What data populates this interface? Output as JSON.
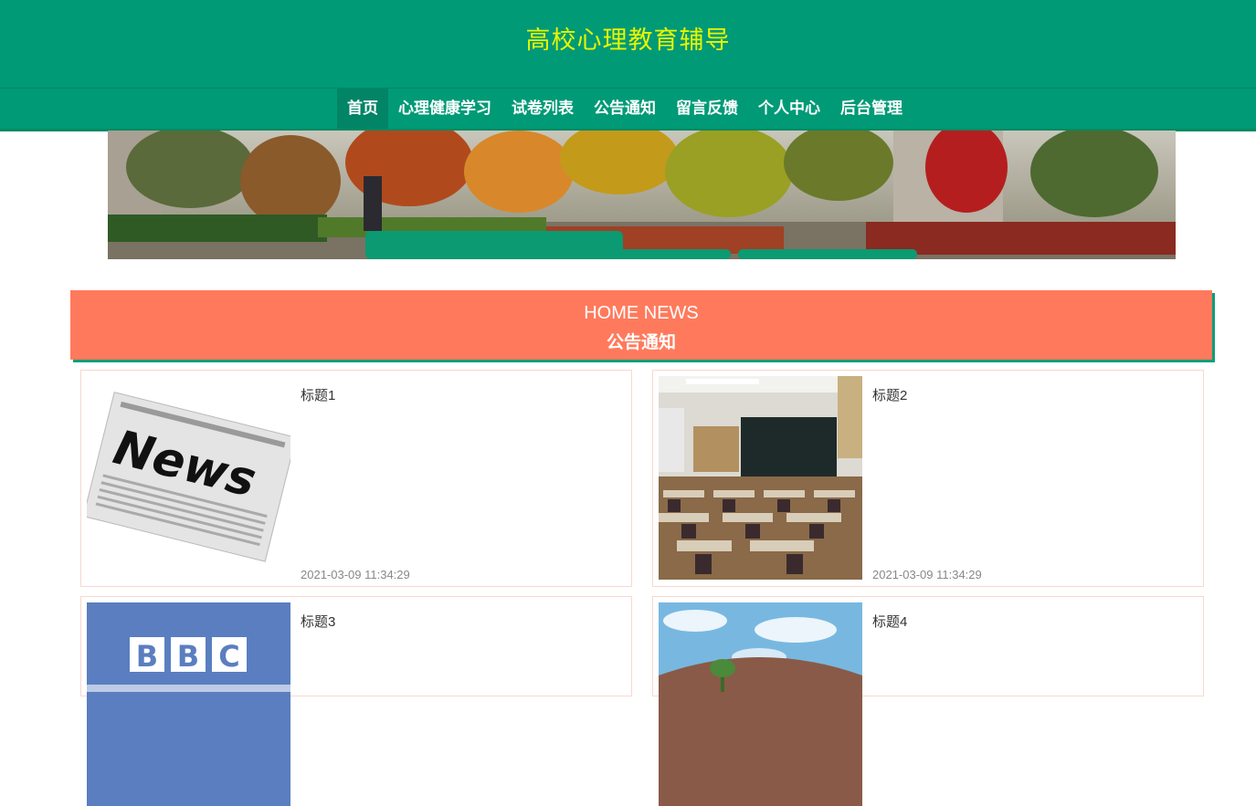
{
  "header": {
    "site_title": "高校心理教育辅导"
  },
  "nav": {
    "items": [
      {
        "label": "首页",
        "active": true
      },
      {
        "label": "心理健康学习"
      },
      {
        "label": "试卷列表"
      },
      {
        "label": "公告通知"
      },
      {
        "label": "留言反馈"
      },
      {
        "label": "个人中心"
      },
      {
        "label": "后台管理"
      }
    ]
  },
  "news_section": {
    "title_en": "HOME NEWS",
    "title_cn": "公告通知"
  },
  "news": [
    {
      "title": "标题1",
      "date": "2021-03-09 11:34:29",
      "image": "newspaper"
    },
    {
      "title": "标题2",
      "date": "2021-03-09 11:34:29",
      "image": "classroom"
    },
    {
      "title": "标题3",
      "date": "",
      "image": "bbc-logo"
    },
    {
      "title": "标题4",
      "date": "",
      "image": "sky-stadium"
    }
  ],
  "colors": {
    "primary": "#009a77",
    "accent": "#ff7a5c",
    "title": "#e9f500"
  }
}
